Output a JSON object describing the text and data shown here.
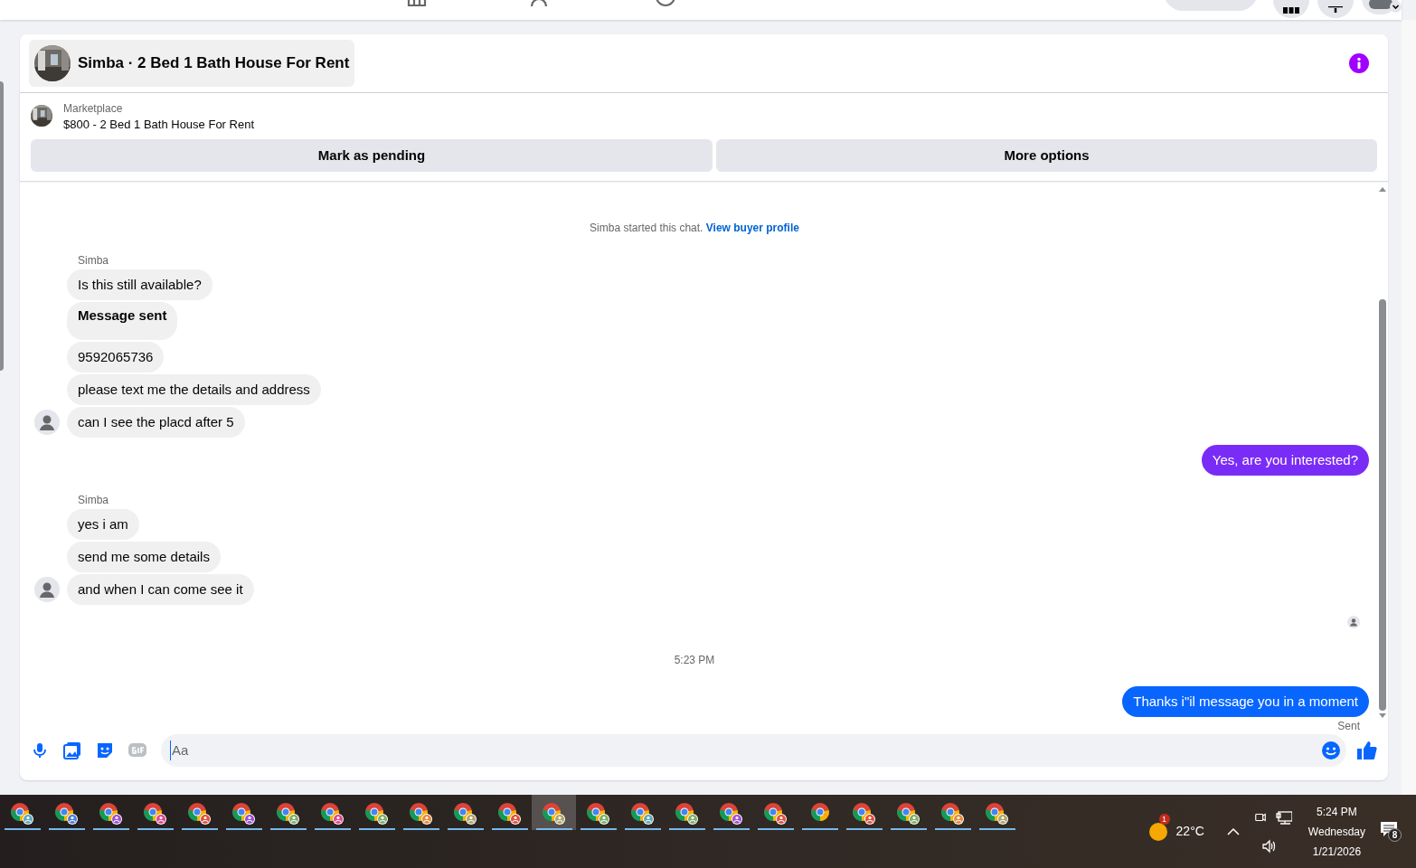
{
  "conversation": {
    "title": "Simba · 2 Bed 1 Bath House For Rent"
  },
  "listing": {
    "source": "Marketplace",
    "title": "$800 - 2 Bed 1 Bath House For Rent"
  },
  "actions": [
    "Mark as pending",
    "More options"
  ],
  "messages": [
    {
      "kind": "system",
      "text": "Simba started this chat.",
      "link": "View buyer profile"
    },
    {
      "kind": "incoming",
      "sender": "Simba",
      "messages": [
        {
          "text": "Is this still available?",
          "bold": false
        },
        {
          "text": "Message sent",
          "bold": true
        },
        {
          "text": "9592065736",
          "bold": false
        },
        {
          "text": "please text me the details and address",
          "bold": false
        },
        {
          "text": "can I see the placd after 5",
          "bold": false
        }
      ]
    },
    {
      "kind": "outgoing",
      "text": "Yes, are you interested?",
      "color": "#7a2cf7"
    },
    {
      "kind": "incoming",
      "sender": "Simba",
      "messages": [
        {
          "text": "yes i am",
          "bold": false
        },
        {
          "text": "send me some details",
          "bold": false
        },
        {
          "text": "and when I can come see it",
          "bold": false
        }
      ]
    },
    {
      "kind": "seen"
    },
    {
      "kind": "time",
      "text": "5:23 PM"
    },
    {
      "kind": "outgoing",
      "text": "Thanks i\"il message you in a moment",
      "color": "#0866ff",
      "status": "Sent"
    }
  ],
  "composer": {
    "placeholder": "Aa"
  },
  "taskbar": {
    "apps": [
      {
        "kind": "profile",
        "color": "#5fa8b8",
        "selected": false
      },
      {
        "kind": "profile",
        "color": "#4a7fd6",
        "selected": false
      },
      {
        "kind": "profile",
        "color": "#a04fd6",
        "selected": false
      },
      {
        "kind": "profile",
        "color": "#e0458f",
        "selected": false
      },
      {
        "kind": "profile",
        "color": "#e0503c",
        "selected": false
      },
      {
        "kind": "profile",
        "color": "#9a4fd6",
        "selected": false
      },
      {
        "kind": "profile",
        "color": "#7fae6a",
        "selected": false
      },
      {
        "kind": "profile",
        "color": "#e0458f",
        "selected": false
      },
      {
        "kind": "profile",
        "color": "#7fae6a",
        "selected": false
      },
      {
        "kind": "profile",
        "color": "#e58a3a",
        "selected": false
      },
      {
        "kind": "profile",
        "color": "#b0a46a",
        "selected": false
      },
      {
        "kind": "profile",
        "color": "#e0503c",
        "selected": false
      },
      {
        "kind": "profile",
        "color": "#b0a46a",
        "selected": true
      },
      {
        "kind": "profile",
        "color": "#7fae6a",
        "selected": false
      },
      {
        "kind": "profile",
        "color": "#5fa8b8",
        "selected": false
      },
      {
        "kind": "profile",
        "color": "#7fae6a",
        "selected": false
      },
      {
        "kind": "profile",
        "color": "#a04fd6",
        "selected": false
      },
      {
        "kind": "profile",
        "color": "#e0503c",
        "selected": false
      },
      {
        "kind": "plain",
        "selected": false
      },
      {
        "kind": "profile",
        "color": "#e0503c",
        "selected": false
      },
      {
        "kind": "profile",
        "color": "#7fae6a",
        "selected": false
      },
      {
        "kind": "profile",
        "color": "#e58a3a",
        "selected": false
      },
      {
        "kind": "profile",
        "color": "#b0a46a",
        "selected": false
      }
    ],
    "weather": {
      "temperature": "22°C",
      "badge": "1"
    },
    "clock": {
      "time": "5:24 PM",
      "day": "Wednesday",
      "date": "1/21/2026"
    },
    "notifications": "8"
  }
}
